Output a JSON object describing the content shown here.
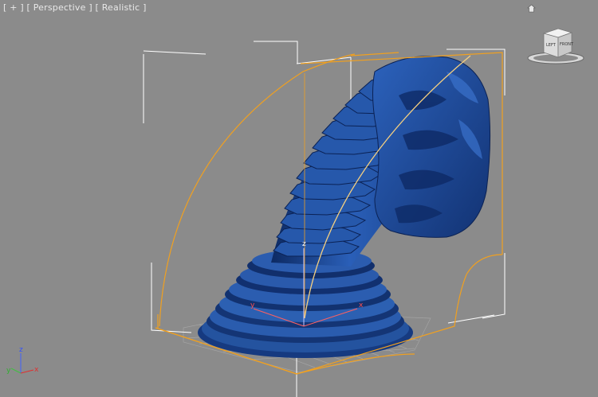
{
  "viewport": {
    "menu_label": "+",
    "view_label": "Perspective",
    "shading_label": "Realistic"
  },
  "viewcube": {
    "left_face": "LEFT",
    "front_face": "FRONT",
    "icon": "viewcube-icon"
  },
  "home": {
    "icon": "home-icon"
  },
  "gizmo": {
    "x_label": "x",
    "y_label": "y",
    "z_label": "z"
  },
  "axis_tripod": {
    "x_label": "x",
    "y_label": "y",
    "z_label": "z"
  },
  "colors": {
    "background": "#8b8b8b",
    "mesh_blue": "#1f4f9e",
    "selection_orange": "#f0a020",
    "bounding_white": "#ffffff",
    "axis_x": "#e03030",
    "axis_y": "#40c040",
    "axis_z": "#4060ff"
  }
}
